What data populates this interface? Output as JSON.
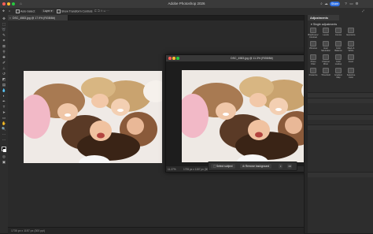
{
  "app": {
    "title": "Adobe Photoshop 2026",
    "share_label": "Share"
  },
  "options_bar": {
    "auto_select_label": "Auto-Select:",
    "layer_value": "Layer",
    "show_transform_label": "Show Transform Controls"
  },
  "document": {
    "tab_title": "DSC_4583.jpg @ 17.9% (RGB/8#)",
    "status_text": "1735 px x 1157 px (300 ppi)"
  },
  "float_window": {
    "title": "DSC_4583.jpg @ 11.3% (RGB/8#)",
    "zoom": "11.27%",
    "info": "1735 px x 1157 px (300 ppi)"
  },
  "context_bar": {
    "select_subject": "Select subject",
    "remove_background": "Remove background",
    "more": "•••"
  },
  "adjustments": {
    "tab_label": "Adjustments",
    "section_title": "Single adjustments",
    "items": [
      {
        "label": "Brightness/\nContrast"
      },
      {
        "label": "Levels"
      },
      {
        "label": "Curves"
      },
      {
        "label": "Exposure"
      },
      {
        "label": "Vibrance"
      },
      {
        "label": "Hue/\nSaturation"
      },
      {
        "label": "Color\nBalance"
      },
      {
        "label": "Black &\nWhite"
      },
      {
        "label": "Photo\nFilter"
      },
      {
        "label": "Channel\nMixer"
      },
      {
        "label": "Color\nLookup"
      },
      {
        "label": "Invert"
      },
      {
        "label": "Posterize"
      },
      {
        "label": "Threshold"
      },
      {
        "label": "Gradient\nMap"
      },
      {
        "label": "Selective\nColor"
      }
    ]
  },
  "colors": {
    "accent": "#2f6fe0",
    "app_bg": "#2a2a2a",
    "panel": "#2d2d2d"
  }
}
